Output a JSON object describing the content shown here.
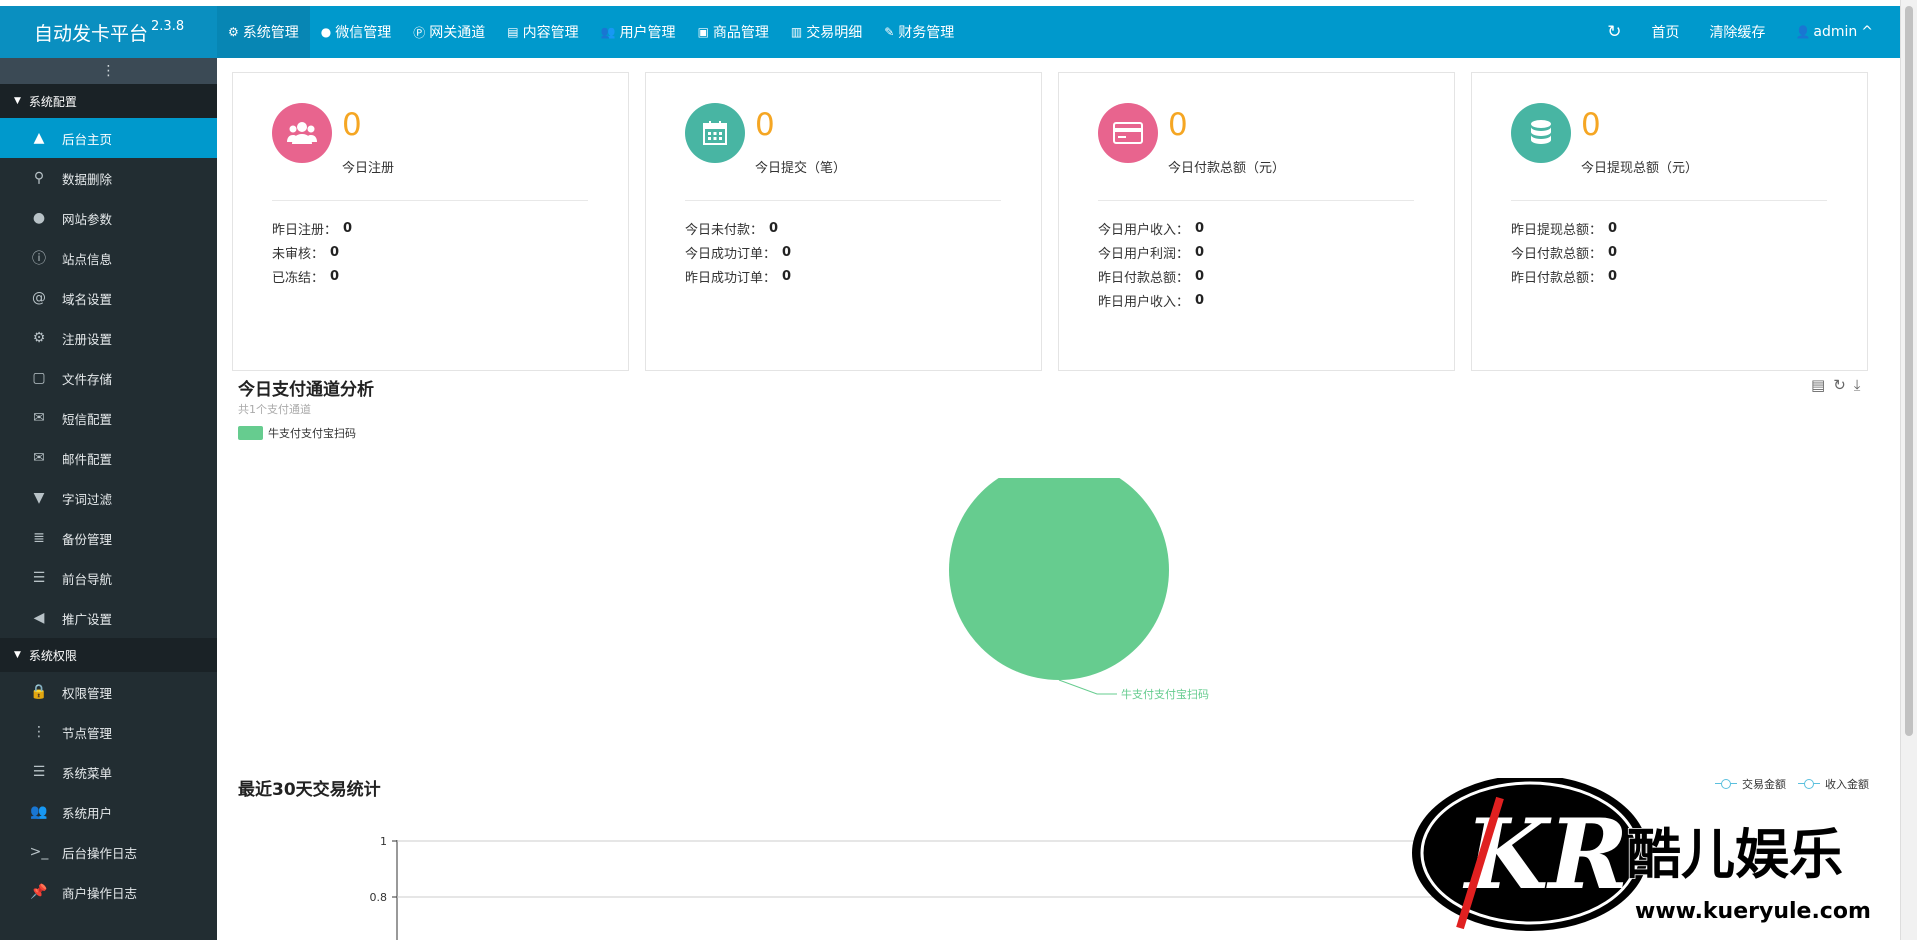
{
  "brand": {
    "name": "自动发卡平台",
    "version": "2.3.8"
  },
  "topnav": [
    {
      "label": "系统管理",
      "icon": "gear-icon",
      "glyph": "⚙",
      "active": true
    },
    {
      "label": "微信管理",
      "icon": "wechat-icon",
      "glyph": "●"
    },
    {
      "label": "网关通道",
      "icon": "gateway-icon",
      "glyph": "Ⓟ"
    },
    {
      "label": "内容管理",
      "icon": "document-icon",
      "glyph": "▤"
    },
    {
      "label": "用户管理",
      "icon": "users-icon",
      "glyph": "👥"
    },
    {
      "label": "商品管理",
      "icon": "shopping-bag-icon",
      "glyph": "▣"
    },
    {
      "label": "交易明细",
      "icon": "chart-icon",
      "glyph": "▥"
    },
    {
      "label": "财务管理",
      "icon": "finance-icon",
      "glyph": "✎"
    }
  ],
  "topright": {
    "refresh_icon": "↻",
    "home": "首页",
    "clear_cache": "清除缓存",
    "user": "admin",
    "user_icon": "👤",
    "caret": "^"
  },
  "sidebar": {
    "toggle_glyph": "⋮",
    "groups": [
      {
        "label": "系统配置",
        "items": [
          {
            "label": "后台主页",
            "icon": "area-chart-icon",
            "glyph": "▲",
            "active": true
          },
          {
            "label": "数据删除",
            "icon": "link-icon",
            "glyph": "⚲"
          },
          {
            "label": "网站参数",
            "icon": "apple-icon",
            "glyph": "●"
          },
          {
            "label": "站点信息",
            "icon": "info-icon",
            "glyph": "ⓘ"
          },
          {
            "label": "域名设置",
            "icon": "at-icon",
            "glyph": "@"
          },
          {
            "label": "注册设置",
            "icon": "gear-icon",
            "glyph": "⚙"
          },
          {
            "label": "文件存储",
            "icon": "save-icon",
            "glyph": "▢"
          },
          {
            "label": "短信配置",
            "icon": "envelope-icon",
            "glyph": "✉"
          },
          {
            "label": "邮件配置",
            "icon": "envelope-icon",
            "glyph": "✉"
          },
          {
            "label": "字词过滤",
            "icon": "filter-icon",
            "glyph": "▼"
          },
          {
            "label": "备份管理",
            "icon": "database-icon",
            "glyph": "≣"
          },
          {
            "label": "前台导航",
            "icon": "bars-icon",
            "glyph": "☰"
          },
          {
            "label": "推广设置",
            "icon": "bullhorn-icon",
            "glyph": "◀"
          }
        ]
      },
      {
        "label": "系统权限",
        "items": [
          {
            "label": "权限管理",
            "icon": "lock-icon",
            "glyph": "🔒"
          },
          {
            "label": "节点管理",
            "icon": "vertical-dots-icon",
            "glyph": "⋮"
          },
          {
            "label": "系统菜单",
            "icon": "list-icon",
            "glyph": "☰"
          },
          {
            "label": "系统用户",
            "icon": "users-icon",
            "glyph": "👥"
          },
          {
            "label": "后台操作日志",
            "icon": "terminal-icon",
            "glyph": ">_"
          },
          {
            "label": "商户操作日志",
            "icon": "pin-icon",
            "glyph": "📌"
          }
        ]
      }
    ]
  },
  "cards": [
    {
      "value": "0",
      "title": "今日注册",
      "icon": "users-icon",
      "color": "#e8648e",
      "rows": [
        {
          "label": "昨日注册：",
          "value": "0"
        },
        {
          "label": "未审核：",
          "value": "0"
        },
        {
          "label": "已冻结：",
          "value": "0"
        }
      ]
    },
    {
      "value": "0",
      "title": "今日提交（笔）",
      "icon": "calendar-icon",
      "color": "#48b5a3",
      "rows": [
        {
          "label": "今日未付款：",
          "value": "0"
        },
        {
          "label": "今日成功订单：",
          "value": "0"
        },
        {
          "label": "昨日成功订单：",
          "value": "0"
        }
      ]
    },
    {
      "value": "0",
      "title": "今日付款总额（元）",
      "icon": "credit-card-icon",
      "color": "#e8648e",
      "rows": [
        {
          "label": "今日用户收入：",
          "value": "0"
        },
        {
          "label": "今日用户利润：",
          "value": "0"
        },
        {
          "label": "昨日付款总额：",
          "value": "0"
        },
        {
          "label": "昨日用户收入：",
          "value": "0"
        }
      ]
    },
    {
      "value": "0",
      "title": "今日提现总额（元）",
      "icon": "database-icon",
      "color": "#48b5a3",
      "rows": [
        {
          "label": "昨日提现总额：",
          "value": "0"
        },
        {
          "label": "今日付款总额：",
          "value": "0"
        },
        {
          "label": "昨日付款总额：",
          "value": "0"
        }
      ]
    }
  ],
  "pie_section": {
    "title": "今日支付通道分析",
    "subtitle": "共1个支付通道",
    "tool_icons": [
      "data-view-icon",
      "refresh-icon",
      "download-icon"
    ]
  },
  "line_section": {
    "title": "最近30天交易统计"
  },
  "chart_data": [
    {
      "type": "pie",
      "title": "今日支付通道分析",
      "subtitle": "共1个支付通道",
      "legend_position": "top-left",
      "slices": [
        {
          "name": "牛支付支付宝扫码",
          "value": 1,
          "color": "#66cc8f"
        }
      ]
    },
    {
      "type": "line",
      "title": "最近30天交易统计",
      "legend_position": "top-right",
      "series": [
        {
          "name": "交易金额",
          "color": "#5bc0de",
          "values": []
        },
        {
          "name": "收入金额",
          "color": "#5bc0de",
          "values": []
        }
      ],
      "yticks": [
        "1",
        "0.8"
      ],
      "ylim": [
        0,
        1
      ],
      "grid": true
    }
  ],
  "watermark": {
    "logo_text": "KR",
    "name": "酷儿娱乐",
    "url": "www.kueryule.com"
  }
}
